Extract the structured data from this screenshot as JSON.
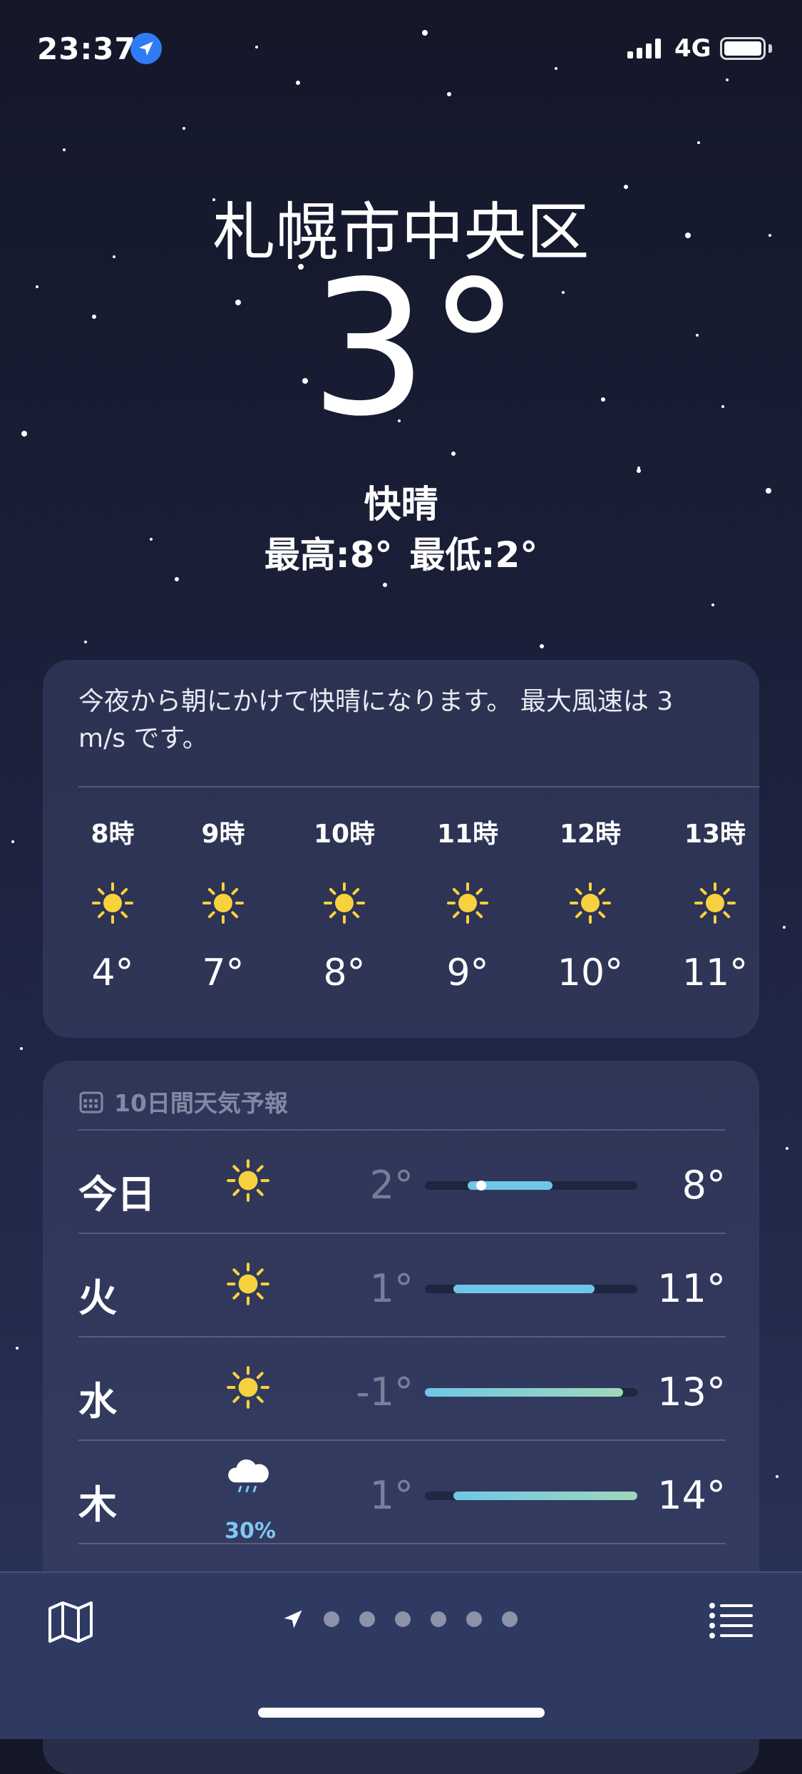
{
  "status_bar": {
    "time": "23:37",
    "network": "4G"
  },
  "location": "札幌市中央区",
  "current": {
    "temperature": "3°",
    "condition": "快晴",
    "high": "最高:8°",
    "low": "最低:2°"
  },
  "summary": "今夜から朝にかけて快晴になります。 最大風速は 3 m/s です。",
  "hourly": [
    {
      "time": "8時",
      "icon": "sun-icon",
      "temp": "4°"
    },
    {
      "time": "9時",
      "icon": "sun-icon",
      "temp": "7°"
    },
    {
      "time": "10時",
      "icon": "sun-icon",
      "temp": "8°"
    },
    {
      "time": "11時",
      "icon": "sun-icon",
      "temp": "9°"
    },
    {
      "time": "12時",
      "icon": "sun-icon",
      "temp": "10°"
    },
    {
      "time": "13時",
      "icon": "sun-icon",
      "temp": "11°"
    }
  ],
  "daily": {
    "title": "10日間天気予報",
    "days": [
      {
        "day": "今日",
        "icon": "sun-icon",
        "low": "2°",
        "high": "8°",
        "low_value": 2,
        "high_value": 8,
        "current_value": 3,
        "precip": ""
      },
      {
        "day": "火",
        "icon": "sun-icon",
        "low": "1°",
        "high": "11°",
        "low_value": 1,
        "high_value": 11,
        "precip": ""
      },
      {
        "day": "水",
        "icon": "sun-icon",
        "low": "-1°",
        "high": "13°",
        "low_value": -1,
        "high_value": 13,
        "precip": ""
      },
      {
        "day": "木",
        "icon": "rain-cloud-icon",
        "low": "1°",
        "high": "14°",
        "low_value": 1,
        "high_value": 14,
        "precip": "30%"
      }
    ],
    "scale_min": -1,
    "scale_max": 14
  },
  "pager": {
    "pages": 6,
    "current": "location-arrow"
  },
  "colors": {
    "sun": "#f7d23e",
    "range_cool": "#6fc7e8",
    "range_warm": "#9fd8b8",
    "location_badge": "#2f7cf6"
  }
}
